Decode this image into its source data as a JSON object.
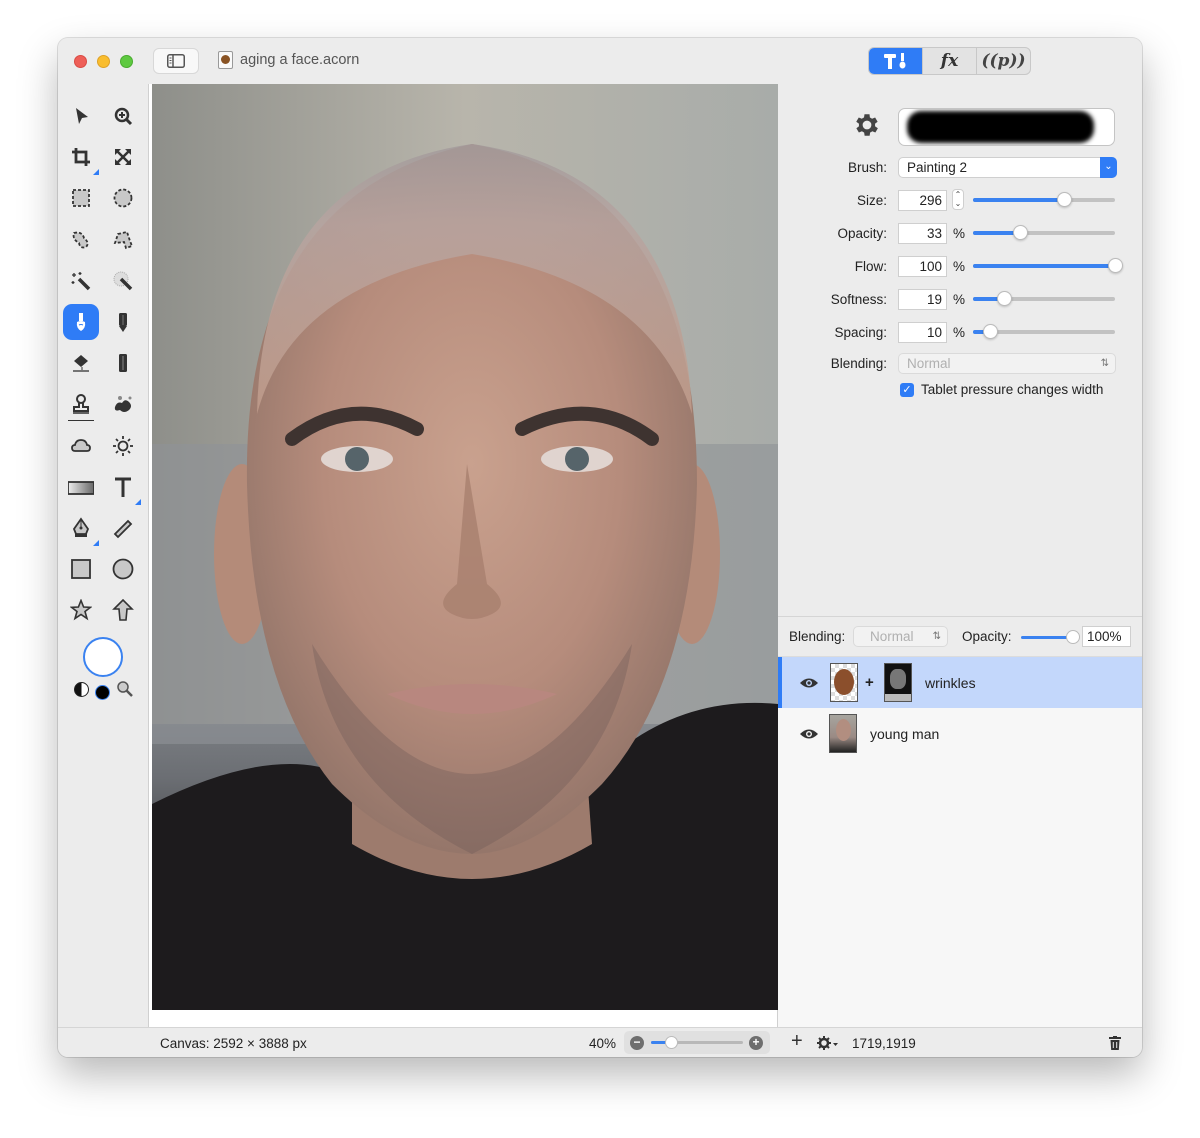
{
  "window": {
    "title": "aging a face.acorn",
    "mode_tabs": [
      {
        "id": "tools",
        "label": "T!",
        "active": true
      },
      {
        "id": "effects",
        "label": "fx",
        "active": false
      },
      {
        "id": "plugins",
        "label": "(p)",
        "active": false
      }
    ]
  },
  "toolbar": {
    "tools": [
      {
        "name": "select-tool",
        "icon": "arrow-pointer-icon"
      },
      {
        "name": "zoom-tool",
        "icon": "zoom-in-icon"
      },
      {
        "name": "crop-tool",
        "icon": "crop-icon"
      },
      {
        "name": "transform-tool",
        "icon": "expand-arrows-icon"
      },
      {
        "name": "rect-select-tool",
        "icon": "rect-marquee-icon"
      },
      {
        "name": "ellipse-select-tool",
        "icon": "ellipse-marquee-icon"
      },
      {
        "name": "lasso-tool",
        "icon": "lasso-icon"
      },
      {
        "name": "polygon-lasso-tool",
        "icon": "polygon-lasso-icon"
      },
      {
        "name": "magic-wand-tool",
        "icon": "magic-wand-icon"
      },
      {
        "name": "instant-alpha-tool",
        "icon": "instant-alpha-icon"
      },
      {
        "name": "brush-tool",
        "icon": "brush-icon",
        "selected": true
      },
      {
        "name": "pencil-tool",
        "icon": "pencil-icon"
      },
      {
        "name": "paint-bucket-tool",
        "icon": "paint-bucket-icon"
      },
      {
        "name": "eraser-tool",
        "icon": "eraser-icon"
      },
      {
        "name": "clone-stamp-tool",
        "icon": "stamp-icon"
      },
      {
        "name": "smudge-tool",
        "icon": "splatter-icon"
      },
      {
        "name": "burn-tool",
        "icon": "cloud-icon"
      },
      {
        "name": "dodge-tool",
        "icon": "sun-icon"
      },
      {
        "name": "gradient-tool",
        "icon": "gradient-icon"
      },
      {
        "name": "text-tool",
        "icon": "text-icon"
      },
      {
        "name": "pen-tool",
        "icon": "pen-nib-icon"
      },
      {
        "name": "line-tool",
        "icon": "line-icon"
      },
      {
        "name": "rectangle-tool",
        "icon": "rectangle-icon"
      },
      {
        "name": "oval-tool",
        "icon": "oval-icon"
      },
      {
        "name": "star-tool",
        "icon": "star-icon"
      },
      {
        "name": "arrow-tool",
        "icon": "arrow-up-icon"
      }
    ],
    "colors": {
      "foreground": "#ffffff",
      "background": "#000000"
    }
  },
  "brush_settings": {
    "brush_label": "Brush:",
    "brush_value": "Painting 2",
    "fields": [
      {
        "key": "size",
        "label": "Size:",
        "value": "296",
        "unit": "",
        "slider_fraction": 0.64
      },
      {
        "key": "opacity",
        "label": "Opacity:",
        "value": "33",
        "unit": "%",
        "slider_fraction": 0.33
      },
      {
        "key": "flow",
        "label": "Flow:",
        "value": "100",
        "unit": "%",
        "slider_fraction": 1.0
      },
      {
        "key": "softness",
        "label": "Softness:",
        "value": "19",
        "unit": "%",
        "slider_fraction": 0.22
      },
      {
        "key": "spacing",
        "label": "Spacing:",
        "value": "10",
        "unit": "%",
        "slider_fraction": 0.12
      }
    ],
    "blending_label": "Blending:",
    "blending_value": "Normal",
    "tablet_pressure_label": "Tablet pressure changes width",
    "tablet_pressure_checked": true
  },
  "layers_panel": {
    "blending_label": "Blending:",
    "blending_value": "Normal",
    "opacity_label": "Opacity:",
    "opacity_value": "100%",
    "opacity_fraction": 1.0,
    "layers": [
      {
        "name": "wrinkles",
        "visible": true,
        "selected": true,
        "has_mask": true,
        "mask_separator": "+"
      },
      {
        "name": "young man",
        "visible": true,
        "selected": false,
        "has_mask": false
      }
    ]
  },
  "status_bar": {
    "canvas_info": "Canvas: 2592 × 3888 px",
    "zoom_level": "40%",
    "zoom_fraction": 0.22,
    "cursor_position": "1719,1919"
  },
  "colors": {
    "accent": "#2f7cf6",
    "selected_layer": "#c3d7fb"
  }
}
